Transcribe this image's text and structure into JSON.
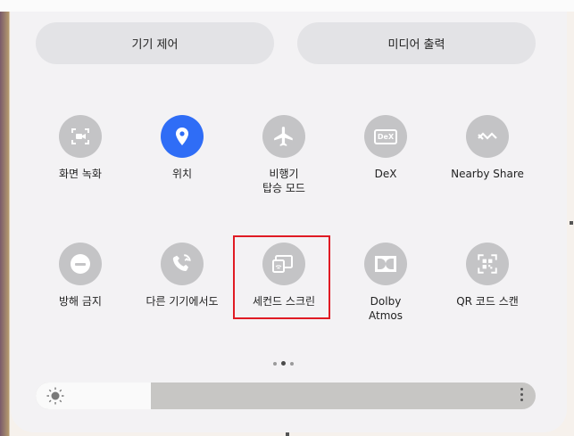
{
  "top_buttons": {
    "device_control": "기기 제어",
    "media_output": "미디어 출력"
  },
  "tiles": [
    {
      "label": "화면 녹화",
      "icon": "screen-record-icon",
      "active": false
    },
    {
      "label": "위치",
      "icon": "location-icon",
      "active": true
    },
    {
      "label": "비행기\n탑승 모드",
      "icon": "airplane-icon",
      "active": false
    },
    {
      "label": "DeX",
      "icon": "dex-icon",
      "active": false
    },
    {
      "label": "Nearby Share",
      "icon": "nearby-share-icon",
      "active": false
    },
    {
      "label": "방해 금지",
      "icon": "do-not-disturb-icon",
      "active": false
    },
    {
      "label": "다른 기기에서도",
      "icon": "call-other-devices-icon",
      "active": false
    },
    {
      "label": "세컨드 스크린",
      "icon": "second-screen-icon",
      "active": false
    },
    {
      "label": "Dolby\nAtmos",
      "icon": "dolby-atmos-icon",
      "active": false
    },
    {
      "label": "QR 코드 스캔",
      "icon": "qr-scan-icon",
      "active": false
    }
  ],
  "dex_icon_text": "DeX",
  "page_indicator": {
    "pages": 3,
    "current": 2
  },
  "brightness": {
    "level": 0.23
  },
  "colors": {
    "active": "#2f6df6",
    "inactive": "#c4c4c6",
    "highlight": "#e01b24"
  }
}
